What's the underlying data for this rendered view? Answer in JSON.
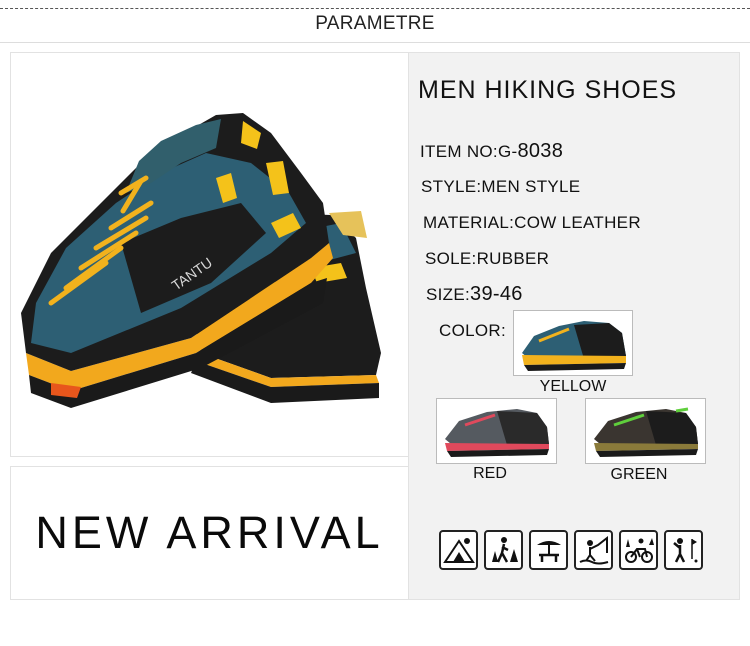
{
  "header": {
    "title": "PARAMETRE"
  },
  "banner": {
    "text": "NEW ARRIVAL"
  },
  "product": {
    "title": "MEN HIKING SHOES",
    "item_no_label": "ITEM NO:",
    "item_no_value_prefix": "G-",
    "item_no_value": "8038",
    "style": "STYLE:MEN STYLE",
    "material": "MATERIAL:COW LEATHER",
    "sole": "SOLE:RUBBER",
    "size_label": "SIZE:",
    "size_value": "39-46",
    "color_label": "COLOR:",
    "brand_print": "TANTU"
  },
  "colors": [
    {
      "name": "YELLOW",
      "accent": "#f2b21d",
      "body": "#2d5f74"
    },
    {
      "name": "RED",
      "accent": "#e0495c",
      "body": "#555a60"
    },
    {
      "name": "GREEN",
      "accent": "#5fcf3c",
      "body": "#3a3530"
    }
  ],
  "activity_icons": [
    "camping-icon",
    "hiking-icon",
    "picnic-icon",
    "fishing-icon",
    "cycling-icon",
    "golf-icon"
  ]
}
